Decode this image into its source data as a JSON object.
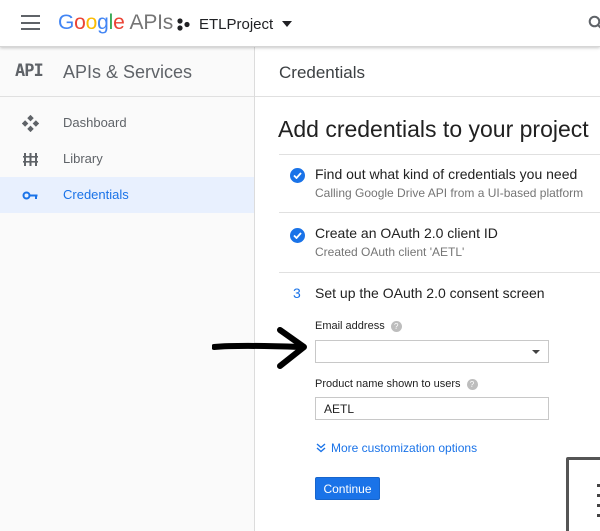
{
  "topbar": {
    "logo": {
      "g1": "G",
      "g2": "o",
      "g3": "o",
      "g4": "g",
      "g5": "l",
      "g6": "e",
      "product": "APIs"
    },
    "project_name": "ETLProject"
  },
  "sidebar": {
    "title": "APIs & Services",
    "api_badge": "API",
    "items": [
      {
        "label": "Dashboard",
        "icon": "dashboard-icon",
        "active": false
      },
      {
        "label": "Library",
        "icon": "library-icon",
        "active": false
      },
      {
        "label": "Credentials",
        "icon": "key-icon",
        "active": true
      }
    ]
  },
  "main": {
    "title": "Credentials",
    "heading": "Add credentials to your project",
    "steps": [
      {
        "title": "Find out what kind of credentials you need",
        "subtitle": "Calling Google Drive API from a UI-based platform",
        "done": true
      },
      {
        "title": "Create an OAuth 2.0 client ID",
        "subtitle": "Created OAuth client 'AETL'",
        "done": true
      },
      {
        "number": "3",
        "title": "Set up the OAuth 2.0 consent screen",
        "done": false
      }
    ],
    "form": {
      "email_label": "Email address",
      "email_value": "",
      "product_label": "Product name shown to users",
      "product_value": "AETL",
      "more_options": "More customization options",
      "continue_label": "Continue"
    }
  },
  "colors": {
    "accent": "#1a73e8",
    "active_bg": "#e8f0fe"
  }
}
